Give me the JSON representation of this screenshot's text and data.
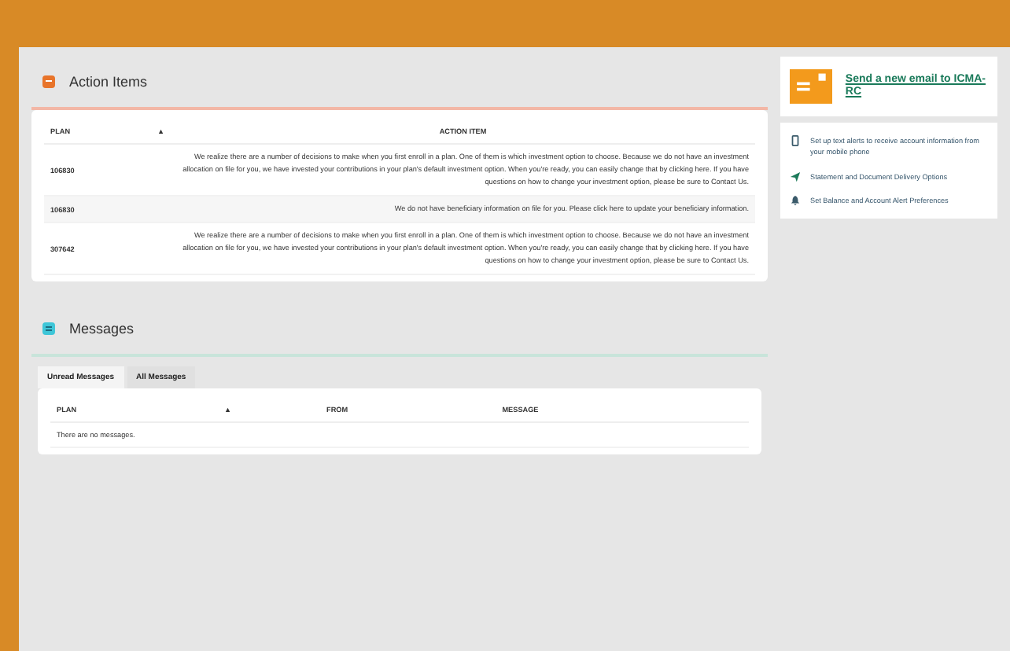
{
  "action_items": {
    "title": "Action Items",
    "columns": [
      "PLAN",
      "▲",
      "ACTION ITEM"
    ],
    "rows": [
      {
        "plan": "106830",
        "item": "We realize there are a number of decisions to make when you first enroll in a plan. One of them is which investment option to choose. Because we do not have an investment allocation on file for you, we have invested your contributions in your plan's default investment option. When you're ready, you can easily change that by clicking here. If you have questions on how to change your investment option, please be sure to Contact Us."
      },
      {
        "plan": "106830",
        "item": "We do not have beneficiary information on file for you. Please click here to update your beneficiary information."
      },
      {
        "plan": "307642",
        "item": "We realize there are a number of decisions to make when you first enroll in a plan. One of them is which investment option to choose. Because we do not have an investment allocation on file for you, we have invested your contributions in your plan's default investment option. When you're ready, you can easily change that by clicking here. If you have questions on how to change your investment option, please be sure to Contact Us."
      }
    ]
  },
  "messages": {
    "title": "Messages",
    "tabs": [
      {
        "label": "Unread Messages",
        "selected": true
      },
      {
        "label": "All Messages",
        "selected": false
      }
    ],
    "columns": [
      "PLAN",
      "▲",
      "FROM",
      "MESSAGE"
    ],
    "empty": "There are no messages."
  },
  "sidebar": {
    "email_link": "Send a new email to ICMA-RC",
    "links": [
      {
        "kind": "phone",
        "label": "Set up text alerts to receive account information from your mobile phone"
      },
      {
        "kind": "send",
        "label": "Statement and Document Delivery Options"
      },
      {
        "kind": "alert",
        "label": "Set Balance and Account Alert Preferences"
      }
    ]
  }
}
